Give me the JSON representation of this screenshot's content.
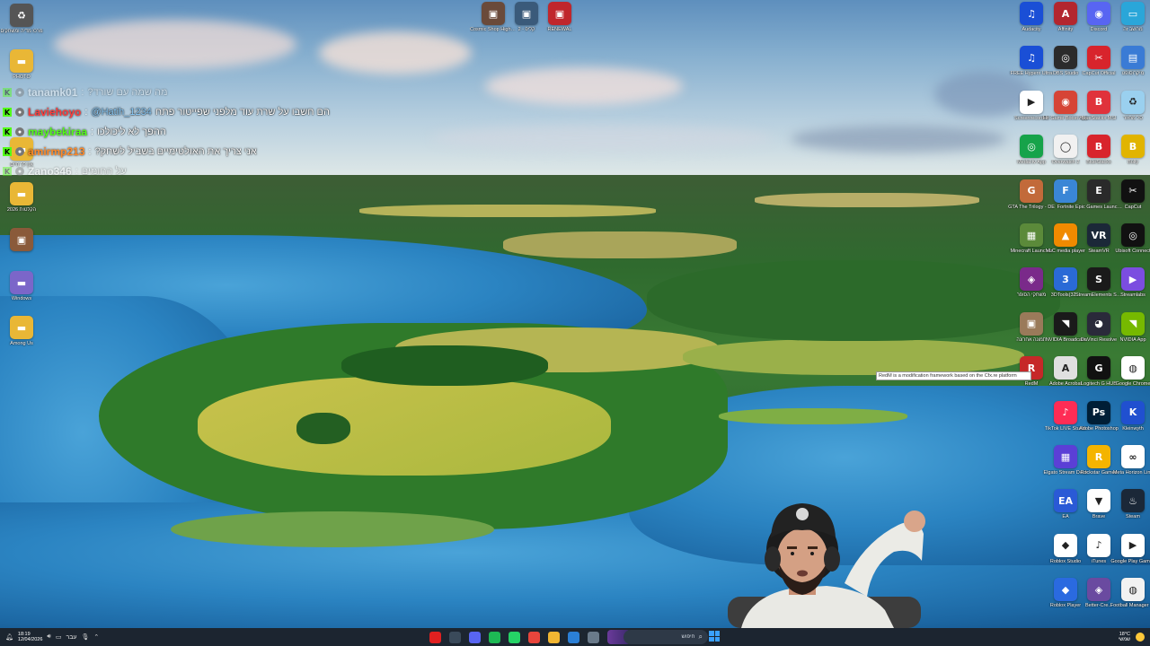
{
  "desktop": {
    "top_left": [
      {
        "label": "מרכז מדיה ומשחקים",
        "icon": "recycle-bin-icon",
        "color": "#555"
      },
      {
        "label": "PHOTO",
        "icon": "folder-icon",
        "color": "#e9b736"
      },
      {
        "label": "",
        "icon": "folder-icon",
        "color": "#e9b736"
      },
      {
        "label": "אין לך חיים",
        "icon": "folder-icon",
        "color": "#e9b736"
      },
      {
        "label": "",
        "icon": "folder-icon",
        "color": "#e9b736"
      },
      {
        "label": "",
        "icon": "folder-icon",
        "color": "#e9b736"
      },
      {
        "label": "הקלטות 2026",
        "icon": "folder-icon",
        "color": "#e9b736"
      },
      {
        "label": "",
        "icon": "photo-icon",
        "color": "#8a5a3a"
      },
      {
        "label": "Windows",
        "icon": "folder-icon",
        "color": "#7b66c9"
      },
      {
        "label": "Among Us",
        "icon": "folder-icon",
        "color": "#e9b736"
      }
    ],
    "top_center": [
      {
        "label": "Cosmic Shop Highlights",
        "icon": "thumbnail-icon",
        "color": "#6a4a3a"
      },
      {
        "label": "2 - קליפ",
        "icon": "thumbnail-icon",
        "color": "#3a5a7a"
      },
      {
        "label": "RENEWAL",
        "icon": "thumbnail-icon",
        "color": "#c0262c"
      }
    ],
    "right_grid": [
      [
        {
          "label": "Audacity",
          "icon": "audacity-icon",
          "color": "#1a4fd6"
        },
        {
          "label": "Affinity",
          "icon": "affinity-icon",
          "color": "#b3262f"
        },
        {
          "label": "Discord",
          "icon": "discord-icon",
          "color": "#5865f2"
        },
        {
          "label": "מחשב זה",
          "icon": "computer-icon",
          "color": "#2aa6d9"
        }
      ],
      [
        {
          "label": "FREE Hyperx Ultra",
          "icon": "audacity-icon",
          "color": "#1a4fd6"
        },
        {
          "label": "OBS Studio",
          "icon": "obs-icon",
          "color": "#2b2b2b"
        },
        {
          "label": "CapCut Official",
          "icon": "capcut-icon",
          "color": "#d8242c"
        },
        {
          "label": "מיקרוסופט",
          "icon": "store-icon",
          "color": "#3a7bd5"
        }
      ],
      [
        {
          "label": "Screenrecorder",
          "icon": "play-icon",
          "color": "#ffffff"
        },
        {
          "label": "Hit Game Boost App",
          "icon": "boost-icon",
          "color": "#d64436"
        },
        {
          "label": "BlueStacks MSI",
          "icon": "bluestacks-icon",
          "color": "#e0323b"
        },
        {
          "label": "סל מחזור",
          "icon": "recycle-bin-icon",
          "color": "#9ad0ef"
        }
      ],
      [
        {
          "label": "Medal.tv App",
          "icon": "medal-icon",
          "color": "#16a34a"
        },
        {
          "label": "Overwatch 2",
          "icon": "overwatch-icon",
          "color": "#f1f1f1"
        },
        {
          "label": "BlueStacks",
          "icon": "bluestacks-icon",
          "color": "#d8242c"
        },
        {
          "label": "Bully",
          "icon": "bully-icon",
          "color": "#e1b400"
        }
      ],
      [
        {
          "label": "GTA The Trilogy - DE",
          "icon": "gta-icon",
          "color": "#c26a3a"
        },
        {
          "label": "Fortnite",
          "icon": "fortnite-icon",
          "color": "#3a86d6"
        },
        {
          "label": "Epic Games Launcher",
          "icon": "epic-icon",
          "color": "#2a2a2a"
        },
        {
          "label": "CapCut",
          "icon": "capcut-icon",
          "color": "#111111"
        }
      ],
      [
        {
          "label": "Minecraft Launcher",
          "icon": "minecraft-icon",
          "color": "#5b8a3a"
        },
        {
          "label": "VLC media player",
          "icon": "vlc-icon",
          "color": "#f08a00"
        },
        {
          "label": "SteamVR",
          "icon": "steamvr-icon",
          "color": "#1b2838"
        },
        {
          "label": "Ubisoft Connect",
          "icon": "ubisoft-icon",
          "color": "#111"
        }
      ],
      [
        {
          "label": "משחקי הסופר",
          "icon": "game-icon",
          "color": "#7a2a8a"
        },
        {
          "label": "3DTools(32...",
          "icon": "tools-icon",
          "color": "#2a6ad6"
        },
        {
          "label": "StreamElements SE.Live",
          "icon": "streamelements-icon",
          "color": "#1a1a1a"
        },
        {
          "label": "Streamlabs",
          "icon": "streamlabs-icon",
          "color": "#7b4de0"
        }
      ],
      [
        {
          "label": "תמונה אחרונה",
          "icon": "photo-icon",
          "color": "#9a7a5a"
        },
        {
          "label": "NVIDIA Broadcast",
          "icon": "nvidia-icon",
          "color": "#1a1a1a"
        },
        {
          "label": "DaVinci Resolve",
          "icon": "davinci-icon",
          "color": "#2a2a3a"
        },
        {
          "label": "NVIDIA App",
          "icon": "nvidia-icon",
          "color": "#76b900"
        }
      ],
      [
        {
          "label": "RedM",
          "icon": "redm-icon",
          "color": "#c62828"
        },
        {
          "label": "Adobe Acrobat",
          "icon": "acrobat-icon",
          "color": "#e0e0e0"
        },
        {
          "label": "Logitech G HUB",
          "icon": "logitech-icon",
          "color": "#111"
        },
        {
          "label": "Google Chrome",
          "icon": "chrome-icon",
          "color": "#ffffff"
        }
      ],
      [
        {
          "label": "",
          "icon": "",
          "color": ""
        },
        {
          "label": "TikTok LIVE Studio",
          "icon": "tiktok-icon",
          "color": "#fe2c55"
        },
        {
          "label": "Adobe Photoshop",
          "icon": "photoshop-icon",
          "color": "#001e36"
        },
        {
          "label": "Kleinwyth",
          "icon": "k-icon",
          "color": "#2050d0"
        }
      ],
      [
        {
          "label": "",
          "icon": "",
          "color": ""
        },
        {
          "label": "Elgato Stream Deck",
          "icon": "streamdeck-icon",
          "color": "#5b3fd6"
        },
        {
          "label": "Rockstar Games",
          "icon": "rockstar-icon",
          "color": "#f4b400"
        },
        {
          "label": "Meta Horizon Link",
          "icon": "meta-icon",
          "color": "#ffffff"
        }
      ],
      [
        {
          "label": "",
          "icon": "",
          "color": ""
        },
        {
          "label": "EA",
          "icon": "ea-icon",
          "color": "#2a5ad6"
        },
        {
          "label": "Brave",
          "icon": "brave-icon",
          "color": "#ffffff"
        },
        {
          "label": "Steam",
          "icon": "steam-icon",
          "color": "#1b2838"
        }
      ],
      [
        {
          "label": "",
          "icon": "",
          "color": ""
        },
        {
          "label": "Roblox Studio",
          "icon": "roblox-icon",
          "color": "#ffffff"
        },
        {
          "label": "iTunes",
          "icon": "itunes-icon",
          "color": "#ffffff"
        },
        {
          "label": "Google Play Games",
          "icon": "playgames-icon",
          "color": "#ffffff"
        }
      ],
      [
        {
          "label": "",
          "icon": "",
          "color": ""
        },
        {
          "label": "Roblox Player",
          "icon": "roblox-icon",
          "color": "#2a6ae0"
        },
        {
          "label": "Better-Cre...",
          "icon": "game-icon",
          "color": "#6a4aa0"
        },
        {
          "label": "Football Manager 26",
          "icon": "fm-icon",
          "color": "#f2f2f2"
        }
      ]
    ]
  },
  "chat": {
    "messages": [
      {
        "user": "tanamk01",
        "user_color": "#ffffff",
        "message": "?מה שמה עם שורד",
        "faded": true,
        "mention": ""
      },
      {
        "user": "Laviehoyo",
        "user_color": "#ff3b3b",
        "message": "הם חשבו על שרת עוד מלפני שפייטור פתח",
        "faded": false,
        "mention": "@Hatih_1234"
      },
      {
        "user": "maybekiraa",
        "user_color": "#53fc18",
        "message": "ההפך לא ליכולכו",
        "faded": false,
        "mention": ""
      },
      {
        "user": "amirmp213",
        "user_color": "#ff8a2a",
        "message": "?אני צריך את האולטימיים בשביל לשחק",
        "faded": false,
        "mention": ""
      },
      {
        "user": "Zano346",
        "user_color": "#ffffff",
        "message": "על החומים",
        "faded": true,
        "mention": ""
      }
    ]
  },
  "tooltip": {
    "text": "RedM is a modification framework based on the Cfx.re platform"
  },
  "taskbar": {
    "time": "18:19",
    "date": "12/04/2026",
    "lang": "עבר",
    "search_placeholder": "חיפוש",
    "temperature": "18°C",
    "weather_text": "שמשי",
    "apps": [
      {
        "icon": "red-circle-icon",
        "color": "#e02020"
      },
      {
        "icon": "network-icon",
        "color": "#3a4a5a"
      },
      {
        "icon": "discord-icon",
        "color": "#5865f2"
      },
      {
        "icon": "spotify-icon",
        "color": "#1db954"
      },
      {
        "icon": "whatsapp-icon",
        "color": "#25d366"
      },
      {
        "icon": "chrome-icon",
        "color": "#e8453c"
      },
      {
        "icon": "explorer-icon",
        "color": "#f2b632"
      },
      {
        "icon": "photos-icon",
        "color": "#2b7fd6"
      },
      {
        "icon": "app-icon",
        "color": "#6a7a8a"
      }
    ]
  }
}
